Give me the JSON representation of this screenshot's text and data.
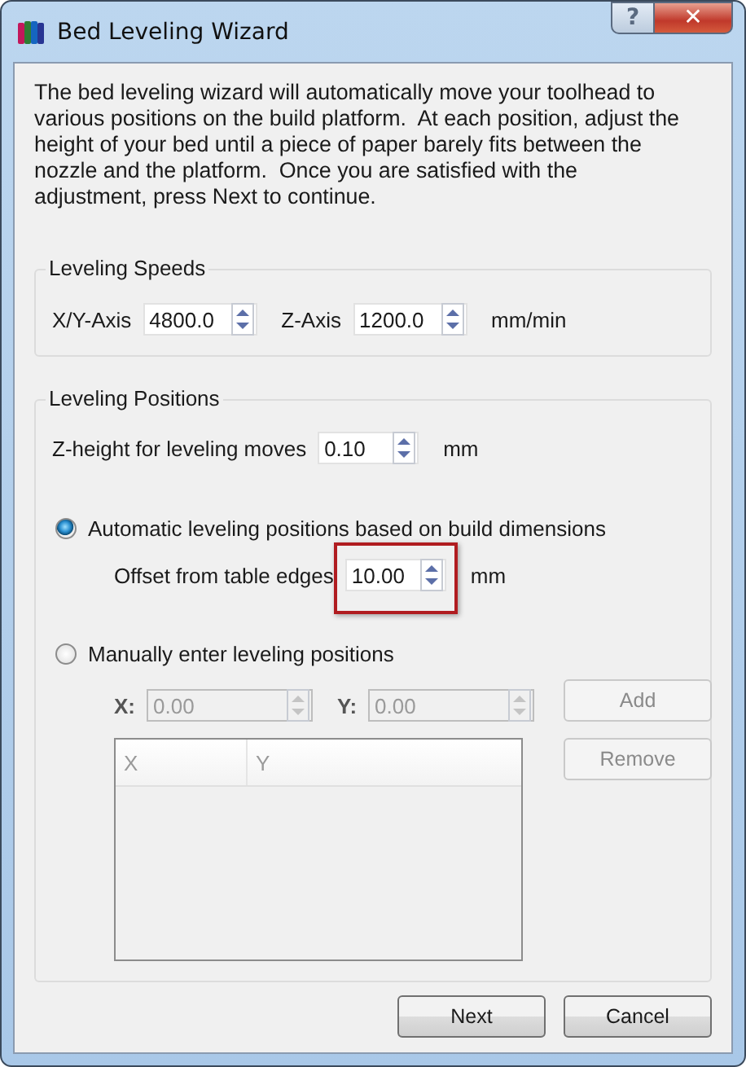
{
  "window": {
    "title": "Bed Leveling Wizard",
    "help_glyph": "?",
    "close_glyph": "✕"
  },
  "intro": "The bed leveling wizard will automatically move your toolhead to various positions on the build platform.  At each position, adjust the height of your bed until a piece of paper barely fits between the nozzle and the platform.  Once you are satisfied with the adjustment, press Next to continue.",
  "speeds": {
    "title": "Leveling Speeds",
    "fields": [
      {
        "label": "X/Y-Axis",
        "value": "4800.0"
      },
      {
        "label": "Z-Axis",
        "value": "1200.0"
      }
    ],
    "unit": "mm/min"
  },
  "positions": {
    "title": "Leveling Positions",
    "z_height": {
      "label": "Z-height for leveling moves",
      "value": "0.10",
      "unit": "mm"
    },
    "options": [
      {
        "label": "Automatic leveling positions based on build dimensions",
        "selected": true
      },
      {
        "label": "Manually enter leveling positions",
        "selected": false
      }
    ],
    "offset": {
      "label": "Offset from table edges",
      "value": "10.00",
      "unit": "mm",
      "highlighted": true
    },
    "manual_fields": [
      {
        "label": "X:",
        "value": "0.00",
        "disabled": true
      },
      {
        "label": "Y:",
        "value": "0.00",
        "disabled": true
      }
    ],
    "side_buttons": [
      {
        "label": "Add",
        "disabled": true
      },
      {
        "label": "Remove",
        "disabled": true
      }
    ],
    "table": {
      "columns": [
        "X",
        "Y"
      ],
      "disabled": true
    }
  },
  "buttons": [
    "Next",
    "Cancel"
  ]
}
